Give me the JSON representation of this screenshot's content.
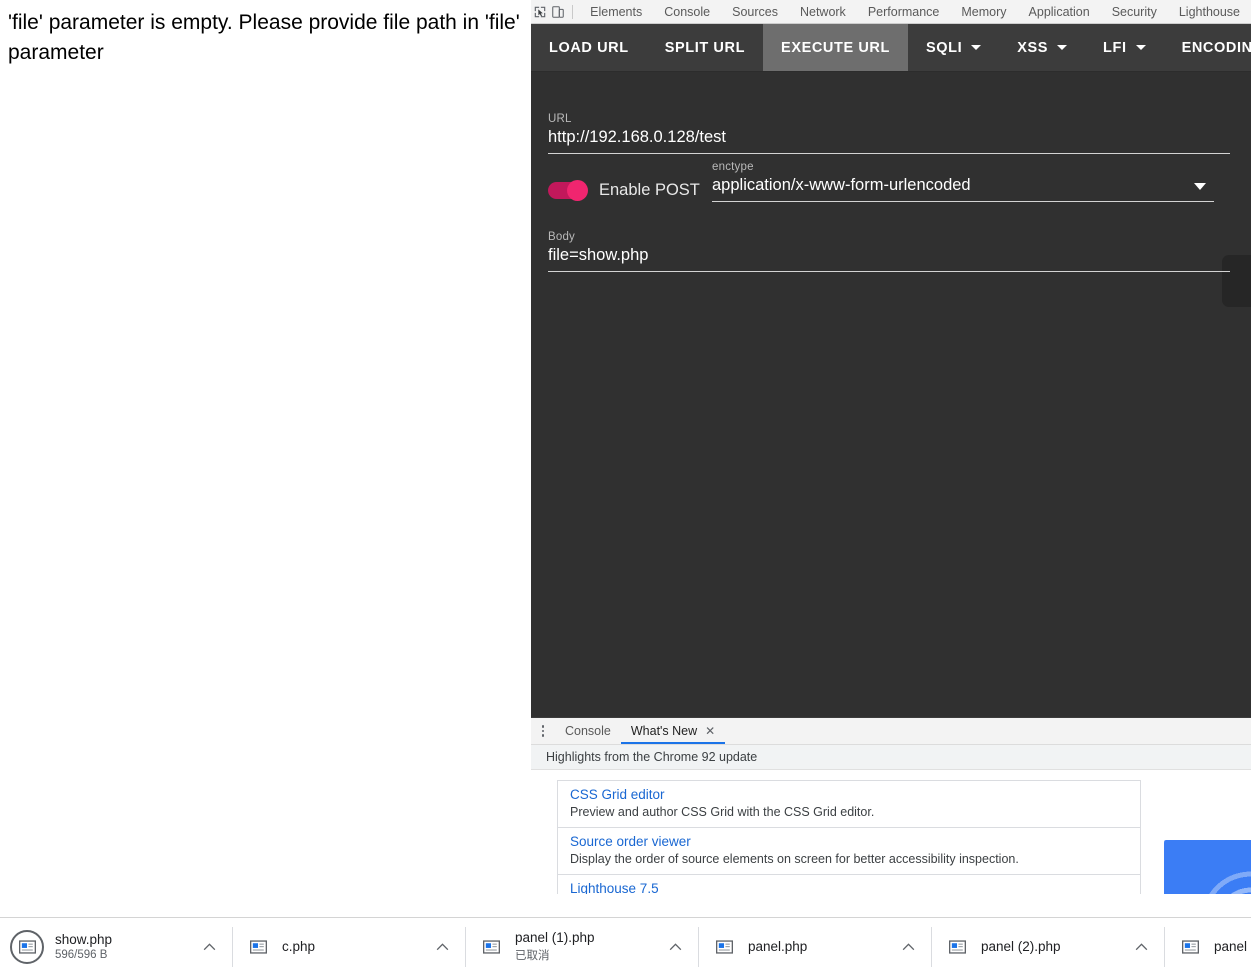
{
  "page": {
    "message": "'file' parameter is empty. Please provide file path in 'file' parameter"
  },
  "devtools": {
    "inspect_icon": "inspect-element-icon",
    "device_icon": "device-toolbar-icon",
    "tabs": [
      {
        "label": "Elements"
      },
      {
        "label": "Console"
      },
      {
        "label": "Sources"
      },
      {
        "label": "Network"
      },
      {
        "label": "Performance"
      },
      {
        "label": "Memory"
      },
      {
        "label": "Application"
      },
      {
        "label": "Security"
      },
      {
        "label": "Lighthouse"
      }
    ]
  },
  "hackbar": {
    "toolbar": [
      {
        "label": "LOAD URL",
        "active": false,
        "caret": false
      },
      {
        "label": "SPLIT URL",
        "active": false,
        "caret": false
      },
      {
        "label": "EXECUTE URL",
        "active": true,
        "caret": false
      },
      {
        "label": "SQLI",
        "active": false,
        "caret": true
      },
      {
        "label": "XSS",
        "active": false,
        "caret": true
      },
      {
        "label": "LFI",
        "active": false,
        "caret": true
      },
      {
        "label": "ENCODING",
        "active": false,
        "caret": false
      }
    ],
    "url_label": "URL",
    "url_value": "http://192.168.0.128/test",
    "post_toggle_label": "Enable POST",
    "post_toggle_on": true,
    "enctype_label": "enctype",
    "enctype_value": "application/x-www-form-urlencoded",
    "body_label": "Body",
    "body_value": "file=show.php"
  },
  "drawer": {
    "tabs": [
      {
        "label": "Console",
        "selected": false
      },
      {
        "label": "What's New",
        "selected": true
      }
    ],
    "close_glyph": "✕",
    "subtitle": "Highlights from the Chrome 92 update",
    "items": [
      {
        "title": "CSS Grid editor",
        "desc": "Preview and author CSS Grid with the CSS Grid editor."
      },
      {
        "title": "Source order viewer",
        "desc": "Display the order of source elements on screen for better accessibility inspection."
      },
      {
        "title": "Lighthouse 7.5",
        "desc": ""
      }
    ]
  },
  "downloads": [
    {
      "name": "show.php",
      "sub": "596/596 B",
      "ring": true,
      "caret": true
    },
    {
      "name": "c.php",
      "sub": "",
      "ring": false,
      "caret": true
    },
    {
      "name": "panel (1).php",
      "sub": "已取消",
      "ring": false,
      "caret": true
    },
    {
      "name": "panel.php",
      "sub": "",
      "ring": false,
      "caret": true
    },
    {
      "name": "panel (2).php",
      "sub": "",
      "ring": false,
      "caret": true
    },
    {
      "name": "panel",
      "sub": "",
      "ring": false,
      "caret": false
    }
  ],
  "colors": {
    "accent_pink": "#f0256f",
    "hackbar_bg": "#303030",
    "toolbar_bg": "#3c3c3c",
    "active_tab_bg": "#6e6e6e",
    "devtools_blue": "#1a73e8"
  }
}
